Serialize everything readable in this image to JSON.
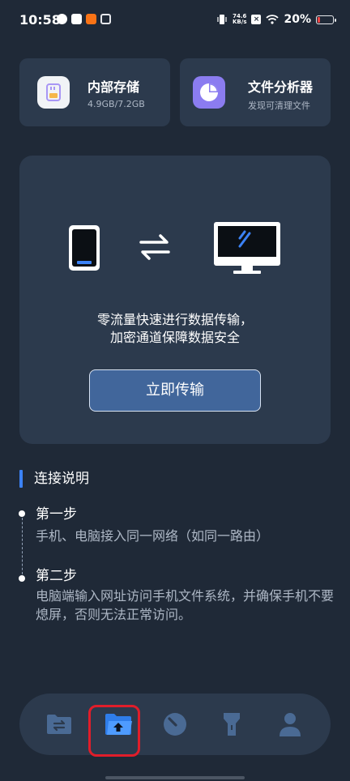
{
  "status_bar": {
    "time": "10:58",
    "net_speed_value": "74.6",
    "net_speed_unit": "KB/s",
    "battery_percent": "20%",
    "battery_level": 0.2
  },
  "cards": {
    "storage": {
      "title": "内部存储",
      "subtitle": "4.9GB/7.2GB",
      "icon": "sd-card-icon"
    },
    "analyzer": {
      "title": "文件分析器",
      "subtitle": "发现可清理文件",
      "icon": "pie-chart-icon"
    }
  },
  "transfer": {
    "line1": "零流量快速进行数据传输，",
    "line2": "加密通道保障数据安全",
    "button_label": "立即传输"
  },
  "instructions": {
    "title": "连接说明",
    "steps": [
      {
        "title": "第一步",
        "desc": "手机、电脑接入同一网络（如同一路由）"
      },
      {
        "title": "第二步",
        "desc": "电脑端输入网址访问手机文件系统，并确保手机不要熄屏，否则无法正常访问。"
      }
    ]
  },
  "bottom_nav": {
    "items": [
      "transfer-folder-icon",
      "upload-folder-icon",
      "clean-icon",
      "flashlight-icon",
      "person-icon"
    ],
    "active_index": 1
  },
  "colors": {
    "background": "#1f2937",
    "card": "#2c3a4d",
    "accent": "#3b82f6",
    "button": "#41669b",
    "highlight": "#e11d2a"
  }
}
